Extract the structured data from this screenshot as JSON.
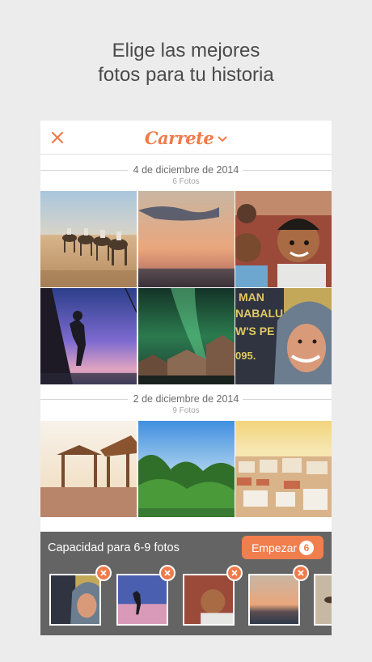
{
  "promo": {
    "line1": "Elige las mejores",
    "line2": "fotos para tu historia"
  },
  "nav": {
    "title": "Carrete",
    "close_icon": "close-icon",
    "dropdown_icon": "chevron-down-icon"
  },
  "sections": [
    {
      "date": "4 de diciembre de 2014",
      "count": "6 Fotos"
    },
    {
      "date": "2 de diciembre de 2014",
      "count": "9 Fotos"
    }
  ],
  "selection": {
    "capacity_label": "Capacidad para 6-9 fotos",
    "start_label": "Empezar",
    "selected_count": "6"
  },
  "colors": {
    "accent": "#f07b4a",
    "background": "#ececec",
    "bar": "#4b4b4b"
  }
}
